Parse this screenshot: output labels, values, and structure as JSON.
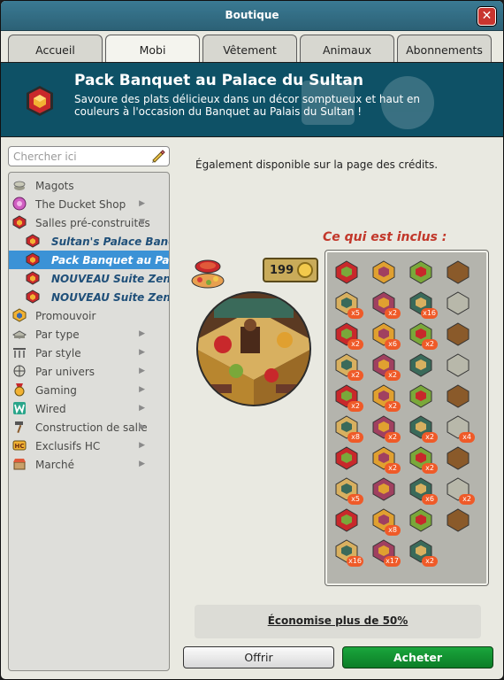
{
  "window": {
    "title": "Boutique",
    "close_label": "✕"
  },
  "tabs": [
    {
      "label": "Accueil"
    },
    {
      "label": "Mobi"
    },
    {
      "label": "Vêtement"
    },
    {
      "label": "Animaux"
    },
    {
      "label": "Abonnements"
    }
  ],
  "active_tab": "Mobi",
  "banner": {
    "title": "Pack Banquet au Palace du Sultan",
    "description": "Savoure des plats délicieux dans un décor somptueux et haut en couleurs à l'occasion du Banquet au Palais du Sultan !"
  },
  "search": {
    "placeholder": "Chercher ici"
  },
  "nav": {
    "items": [
      {
        "label": "Magots",
        "icon": "coins-icon",
        "chevron": false
      },
      {
        "label": "The Ducket Shop",
        "icon": "ducket-icon",
        "chevron": true
      },
      {
        "label": "Salles pré-construites",
        "icon": "room-icon",
        "chevron": true
      },
      {
        "label": "Sultan's Palace Banquet",
        "icon": "room-bundle-icon",
        "sub": true
      },
      {
        "label": "Pack Banquet au Palace du Sultan",
        "icon": "room-bundle-icon",
        "sub": true,
        "selected": true
      },
      {
        "label": "NOUVEAU Suite Zen Deluxe",
        "icon": "room-bundle-icon",
        "sub": true
      },
      {
        "label": "NOUVEAU Suite Zen Deluxe",
        "icon": "room-bundle-icon",
        "sub": true
      },
      {
        "label": "Promouvoir",
        "icon": "promote-icon",
        "chevron": false
      },
      {
        "label": "Par type",
        "icon": "type-icon",
        "chevron": true
      },
      {
        "label": "Par style",
        "icon": "style-icon",
        "chevron": true
      },
      {
        "label": "Par univers",
        "icon": "globe-icon",
        "chevron": true
      },
      {
        "label": "Gaming",
        "icon": "gaming-icon",
        "chevron": true
      },
      {
        "label": "Wired",
        "icon": "wired-icon",
        "chevron": true
      },
      {
        "label": "Construction de salle",
        "icon": "hammer-icon",
        "chevron": true
      },
      {
        "label": "Exclusifs HC",
        "icon": "hc-icon",
        "chevron": true
      },
      {
        "label": "Marché",
        "icon": "market-icon",
        "chevron": true
      }
    ]
  },
  "product": {
    "availability": "Également disponible sur la page des crédits.",
    "price": "199",
    "included_title": "Ce qui est inclus :",
    "items": [
      {
        "qty": ""
      },
      {
        "qty": ""
      },
      {
        "qty": ""
      },
      {
        "qty": ""
      },
      {
        "qty": "x5"
      },
      {
        "qty": "x2"
      },
      {
        "qty": "x16"
      },
      {
        "qty": ""
      },
      {
        "qty": "x2"
      },
      {
        "qty": "x6"
      },
      {
        "qty": "x2"
      },
      {
        "qty": ""
      },
      {
        "qty": "x2"
      },
      {
        "qty": "x2"
      },
      {
        "qty": ""
      },
      {
        "qty": ""
      },
      {
        "qty": "x2"
      },
      {
        "qty": "x2"
      },
      {
        "qty": ""
      },
      {
        "qty": ""
      },
      {
        "qty": "x8"
      },
      {
        "qty": "x2"
      },
      {
        "qty": "x2"
      },
      {
        "qty": "x4"
      },
      {
        "qty": ""
      },
      {
        "qty": "x2"
      },
      {
        "qty": "x2"
      },
      {
        "qty": ""
      },
      {
        "qty": "x5"
      },
      {
        "qty": ""
      },
      {
        "qty": "x6"
      },
      {
        "qty": "x2"
      },
      {
        "qty": ""
      },
      {
        "qty": "x8"
      },
      {
        "qty": ""
      },
      {
        "qty": ""
      },
      {
        "qty": "x16"
      },
      {
        "qty": "x17"
      },
      {
        "qty": "x2"
      }
    ]
  },
  "savings": {
    "label": "Économise plus de 50%"
  },
  "buttons": {
    "offer": "Offrir",
    "buy": "Acheter"
  },
  "colors": {
    "titlebar": "#2c6176",
    "banner": "#0e5166",
    "selected": "#3b92d6",
    "buy": "#0c7d27",
    "qty_badge": "#ef5a28",
    "included_title": "#c2372a"
  }
}
